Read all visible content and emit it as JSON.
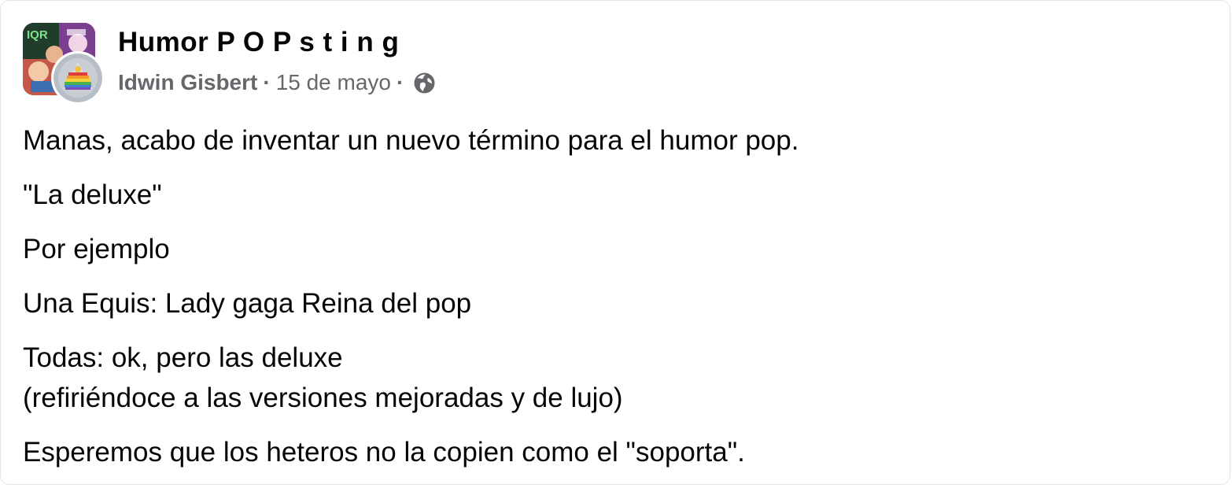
{
  "post": {
    "group_name": "Humor P O P s t i n g",
    "author": "Idwin Gisbert",
    "separator": "·",
    "date": "15 de mayo",
    "audience_icon": "globe-icon",
    "paragraphs": [
      "Manas, acabo de inventar un nuevo término para el humor pop.",
      "\"La deluxe\"",
      "Por ejemplo",
      "Una Equis: Lady gaga Reina del pop",
      "Todas: ok, pero las deluxe",
      "(refiriéndoce a las versiones mejoradas y de lujo)",
      "Esperemos que los heteros no la copien como el \"soporta\"."
    ]
  },
  "colors": {
    "text_primary": "#050505",
    "text_secondary": "#65676b",
    "card_border": "#e4e6eb"
  }
}
